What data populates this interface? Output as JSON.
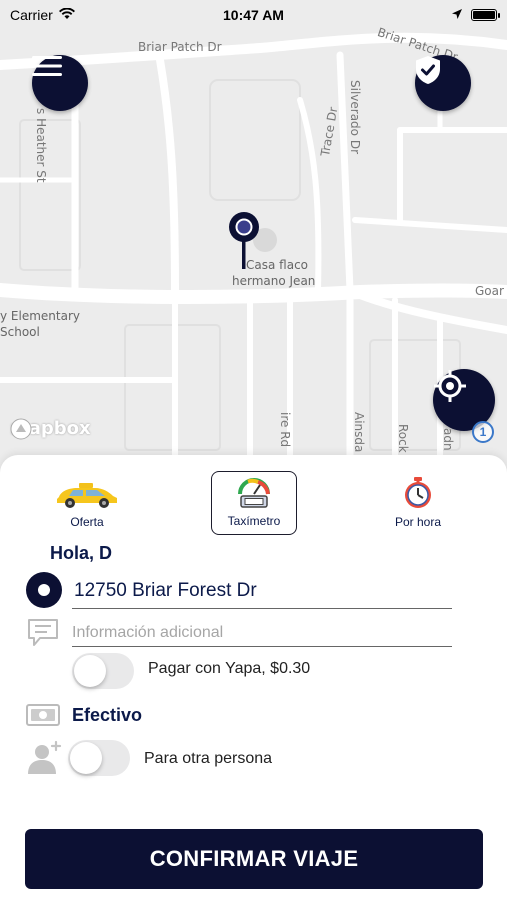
{
  "status_bar": {
    "carrier": "Carrier",
    "time": "10:47 AM"
  },
  "map": {
    "streets": {
      "briar_patch_1": "Briar Patch Dr",
      "briar_patch_2": "Briar Patch Dr",
      "heather": "s Heather St",
      "trace": "Trace Dr",
      "silverado": "Silverado Dr",
      "goar": "Goar",
      "ire_rd": "ire Rd",
      "ainsda": "Ainsda",
      "rock": "Rock",
      "adn": "adn"
    },
    "poi_school": [
      "y Elementary",
      "School"
    ],
    "poi_place": [
      "Casa flaco",
      "hermano Jean"
    ],
    "attribution": "mapbox",
    "info_badge": "1"
  },
  "icons": {
    "menu": "hamburger-menu-icon",
    "safety": "shield-check-icon",
    "locate": "crosshair-locate-icon"
  },
  "services": [
    {
      "label": "Oferta",
      "icon": "taxi-car-icon",
      "selected": false
    },
    {
      "label": "Taxímetro",
      "icon": "taximeter-icon",
      "selected": true
    },
    {
      "label": "Por hora",
      "icon": "stopwatch-icon",
      "selected": false
    }
  ],
  "form": {
    "greeting": "Hola, D",
    "address": "12750 Briar Forest Dr",
    "additional_info_placeholder": "Información adicional",
    "yapa_label": "Pagar con Yapa, $0.30",
    "yapa_enabled": false,
    "payment_method": "Efectivo",
    "other_person_label": "Para otra persona",
    "other_person_enabled": false
  },
  "confirm_button": "CONFIRMAR VIAJE",
  "colors": {
    "primary_dark": "#0c1033",
    "text_dark_blue": "#0c1a4a",
    "map_bg": "#ececec"
  }
}
